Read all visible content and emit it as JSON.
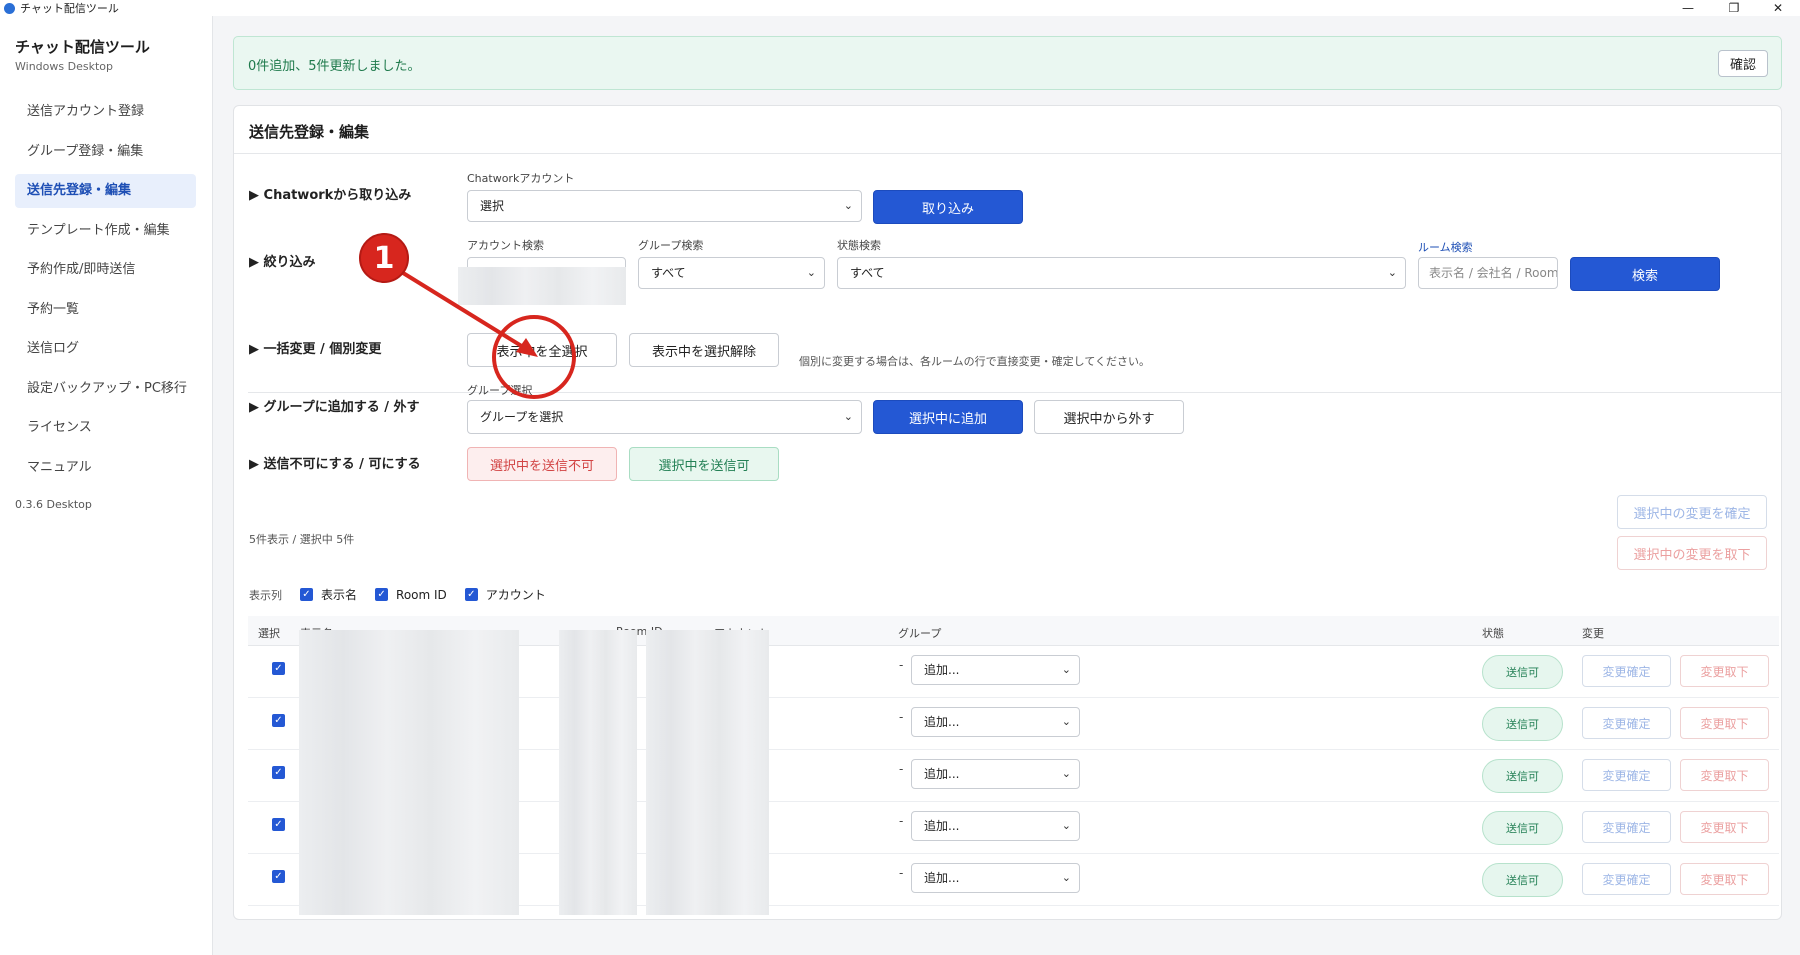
{
  "window": {
    "title": "チャット配信ツール",
    "minimize_glyph": "—",
    "restore_glyph": "❐",
    "close_glyph": "✕"
  },
  "sidebar": {
    "app_name": "チャット配信ツール",
    "platform": "Windows Desktop",
    "items": [
      {
        "label": "送信アカウント登録"
      },
      {
        "label": "グループ登録・編集"
      },
      {
        "label": "送信先登録・編集",
        "active": true
      },
      {
        "label": "テンプレート作成・編集"
      },
      {
        "label": "予約作成/即時送信"
      },
      {
        "label": "予約一覧"
      },
      {
        "label": "送信ログ"
      },
      {
        "label": "設定バックアップ・PC移行"
      },
      {
        "label": "ライセンス"
      },
      {
        "label": "マニュアル"
      }
    ],
    "version": "0.3.6 Desktop"
  },
  "banner": {
    "message": "0件追加、5件更新しました。",
    "confirm_label": "確認"
  },
  "card": {
    "title": "送信先登録・編集",
    "import": {
      "section": "▶ Chatworkから取り込み",
      "account_label": "Chatworkアカウント",
      "account_value": "選択",
      "import_button": "取り込み"
    },
    "filter": {
      "section": "▶ 絞り込み",
      "account_search_label": "アカウント検索",
      "group_search_label": "グループ検索",
      "group_search_value": "すべて",
      "status_search_label": "状態検索",
      "status_search_value": "すべて",
      "room_search_label": "ルーム検索",
      "room_search_placeholder": "表示名 / 会社名 / Room",
      "search_button": "検索"
    },
    "bulk": {
      "section": "▶ 一括変更 / 個別変更",
      "select_all_button": "表示中を全選択",
      "deselect_button": "表示中を選択解除",
      "hint": "個別に変更する場合は、各ルームの行で直接変更・確定してください。"
    },
    "group": {
      "section": "▶ グループに追加する / 外す",
      "label": "グループ選択",
      "select_value": "グループを選択",
      "add_button": "選択中に追加",
      "remove_button": "選択中から外す"
    },
    "sendable": {
      "section": "▶ 送信不可にする / 可にする",
      "disable_button": "選択中を送信不可",
      "enable_button": "選択中を送信可"
    },
    "confirm_selected": "選択中の変更を確定",
    "cancel_selected": "選択中の変更を取下",
    "count_text": "5件表示 / 選択中 5件",
    "columns": {
      "label": "表示列",
      "items": [
        "表示名",
        "Room ID",
        "アカウント"
      ]
    },
    "table": {
      "headers": {
        "select": "選択",
        "name": "表示名",
        "room_id": "Room ID",
        "account": "アカウント",
        "group": "グループ",
        "status": "状態",
        "change": "変更"
      },
      "rows": [
        {
          "group_dash": "-",
          "group_select": "追加...",
          "status": "送信可",
          "confirm": "変更確定",
          "cancel": "変更取下"
        },
        {
          "group_dash": "-",
          "group_select": "追加...",
          "status": "送信可",
          "confirm": "変更確定",
          "cancel": "変更取下"
        },
        {
          "group_dash": "-",
          "group_select": "追加...",
          "status": "送信可",
          "confirm": "変更確定",
          "cancel": "変更取下"
        },
        {
          "group_dash": "-",
          "group_select": "追加...",
          "status": "送信可",
          "confirm": "変更確定",
          "cancel": "変更取下"
        },
        {
          "group_dash": "-",
          "group_select": "追加...",
          "status": "送信可",
          "confirm": "変更確定",
          "cancel": "変更取下"
        }
      ]
    }
  },
  "annotation": {
    "marker": "1"
  },
  "icons": {
    "chevron": "chevron-down-icon",
    "check": "check-icon"
  },
  "colors": {
    "primary": "#2458d4",
    "success": "#238055",
    "danger": "#d24444",
    "annotation": "#d7261e"
  }
}
